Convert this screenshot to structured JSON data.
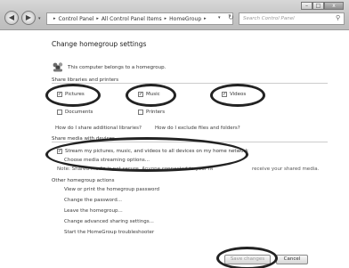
{
  "window": {
    "controls": [
      "–",
      "□",
      "x"
    ]
  },
  "nav": {
    "back_icon": "back-arrow-icon",
    "forward_icon": "forward-arrow-icon"
  },
  "address": {
    "crumbs": [
      "Control Panel",
      "All Control Panel Items",
      "HomeGroup"
    ],
    "sep": "▸"
  },
  "search": {
    "placeholder": "Search Control Panel"
  },
  "page": {
    "title": "Change homegroup settings",
    "belongs_text": "This computer belongs to a homegroup."
  },
  "share_section": {
    "label": "Share libraries and printers",
    "items": [
      {
        "label": "Pictures",
        "checked": "✓"
      },
      {
        "label": "Music",
        "checked": "✓"
      },
      {
        "label": "Videos",
        "checked": "✓"
      },
      {
        "label": "Documents",
        "checked": ""
      },
      {
        "label": "Printers",
        "checked": ""
      }
    ],
    "link_share": "How do I share additional libraries?",
    "link_exclude": "How do I exclude files and folders?"
  },
  "media_section": {
    "label": "Share media with devices",
    "stream_label": "Stream my pictures, music, and videos to all devices on my home network",
    "stream_checked": "✓",
    "stream_link": "Choose media streaming options...",
    "note_left": "Note: Shared media is not secure. Anyone connected to your network can",
    "note_right": "receive your shared media."
  },
  "other_section": {
    "label": "Other homegroup actions",
    "links": [
      "View or print the homegroup password",
      "Change the password...",
      "Leave the homegroup...",
      "Change advanced sharing settings...",
      "Start the HomeGroup troubleshooter"
    ]
  },
  "buttons": {
    "save": "Save changes",
    "cancel": "Cancel"
  }
}
